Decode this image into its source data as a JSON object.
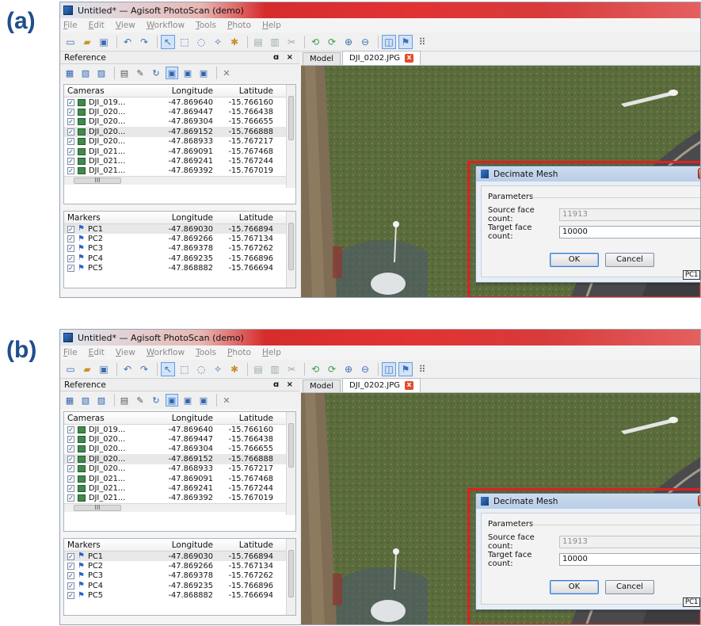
{
  "labels": {
    "a": "(a)",
    "b": "(b)"
  },
  "colors": {
    "highlight": "#e01f1f",
    "label": "#1f4e8c"
  },
  "app": {
    "title": "Untitled* — Agisoft PhotoScan (demo)",
    "menu": [
      "File",
      "Edit",
      "View",
      "Workflow",
      "Tools",
      "Photo",
      "Help"
    ]
  },
  "reference": {
    "title": "Reference",
    "controls": "ɑ ×",
    "cameras": {
      "headers": [
        "Cameras",
        "Longitude",
        "Latitude"
      ],
      "rows": [
        {
          "name": "DJI_019...",
          "lon": "-47.869640",
          "lat": "-15.766160"
        },
        {
          "name": "DJI_020...",
          "lon": "-47.869447",
          "lat": "-15.766438"
        },
        {
          "name": "DJI_020...",
          "lon": "-47.869304",
          "lat": "-15.766655"
        },
        {
          "name": "DJI_020...",
          "lon": "-47.869152",
          "lat": "-15.766888"
        },
        {
          "name": "DJI_020...",
          "lon": "-47.868933",
          "lat": "-15.767217"
        },
        {
          "name": "DJI_021...",
          "lon": "-47.869091",
          "lat": "-15.767468"
        },
        {
          "name": "DJI_021...",
          "lon": "-47.869241",
          "lat": "-15.767244"
        },
        {
          "name": "DJI_021...",
          "lon": "-47.869392",
          "lat": "-15.767019"
        }
      ],
      "hscroll_label": "III"
    },
    "markers": {
      "headers": [
        "Markers",
        "Longitude",
        "Latitude"
      ],
      "rows": [
        {
          "name": "PC1",
          "lon": "-47.869030",
          "lat": "-15.766894"
        },
        {
          "name": "PC2",
          "lon": "-47.869266",
          "lat": "-15.767134"
        },
        {
          "name": "PC3",
          "lon": "-47.869378",
          "lat": "-15.767262"
        },
        {
          "name": "PC4",
          "lon": "-47.869235",
          "lat": "-15.766896"
        },
        {
          "name": "PC5",
          "lon": "-47.868882",
          "lat": "-15.766694"
        }
      ]
    }
  },
  "tabs": {
    "model": "Model",
    "photo": "DJI_0202.JPG",
    "close": "x"
  },
  "dialog": {
    "title": "Decimate Mesh",
    "close": "x",
    "group": "Parameters",
    "source_label": "Source face count:",
    "source_value": "11913",
    "target_label": "Target face count:",
    "target_value": "10000",
    "ok": "OK",
    "cancel": "Cancel"
  },
  "marker_label": "PC1"
}
